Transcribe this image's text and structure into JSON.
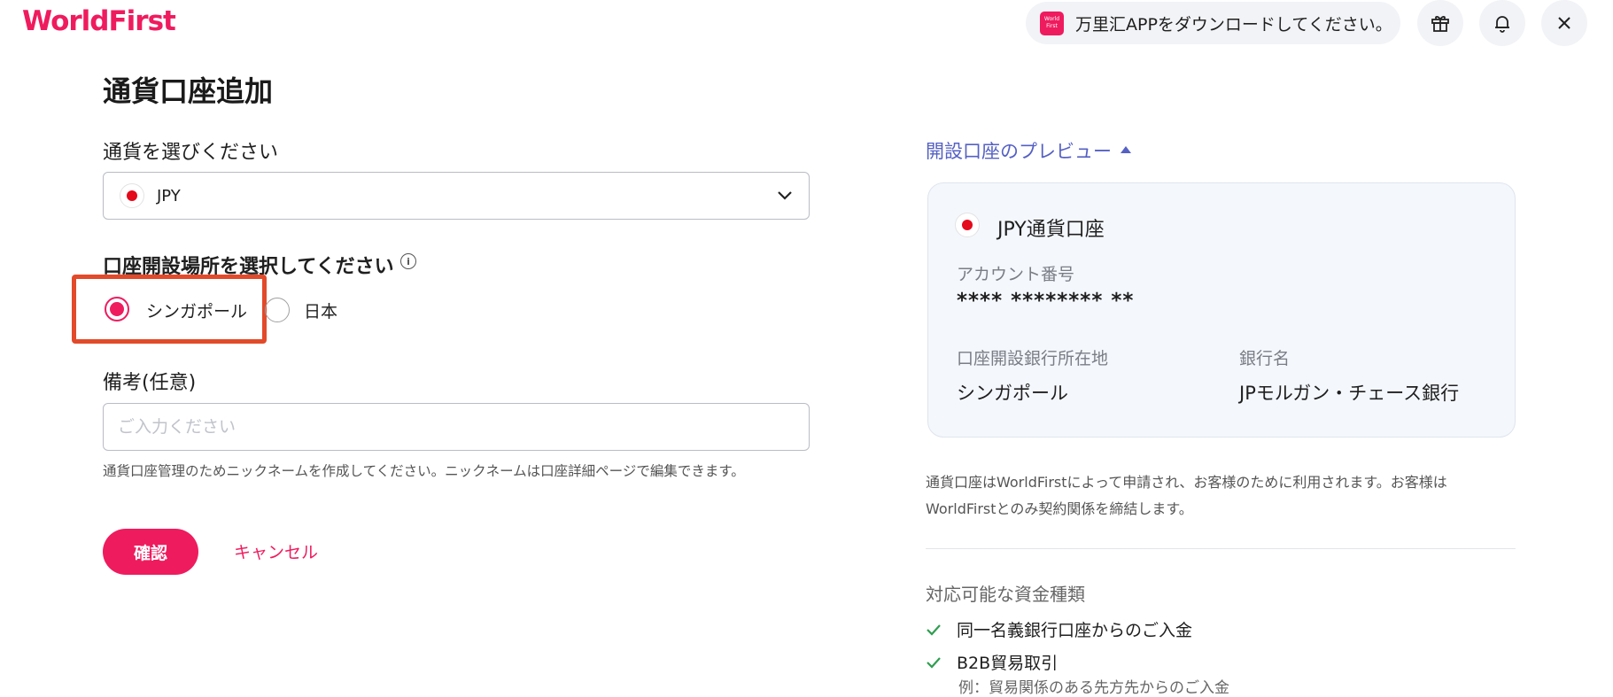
{
  "header": {
    "logo": "WorldFirst",
    "pill_logo_line1": "World",
    "pill_logo_line2": "First",
    "download_text": "万里汇APPをダウンロードしてください。",
    "icons": [
      "gift-icon",
      "bell-icon",
      "close-icon"
    ]
  },
  "form": {
    "title": "通貨口座追加",
    "currency_label": "通貨を選びください",
    "currency_value": "JPY",
    "location_label": "口座開設場所を選択してください",
    "location_options": [
      {
        "label": "シンガポール",
        "selected": true
      },
      {
        "label": "日本",
        "selected": false
      }
    ],
    "remarks_label": "備考(任意)",
    "remarks_placeholder": "ご入力ください",
    "remarks_value": "",
    "hint": "通貨口座管理のためニックネームを作成してください。ニックネームは口座詳細ページで編集できます。",
    "confirm_label": "確認",
    "cancel_label": "キャンセル"
  },
  "preview": {
    "toggle_label": "開設口座のプレビュー",
    "card_title": "JPY通貨口座",
    "account_number_label": "アカウント番号",
    "account_number": "**** ******** **",
    "bank_location_label": "口座開設銀行所在地",
    "bank_location": "シンガポール",
    "bank_name_label": "銀行名",
    "bank_name": "JPモルガン・チェース銀行",
    "note": "通貨口座はWorldFirstによって申請され、お客様のために利用されます。お客様はWorldFirstとのみ契約関係を締結します。",
    "fund_types_title": "対応可能な資金種類",
    "fund_types": [
      "同一名義銀行口座からのご入金",
      "B2B貿易取引"
    ],
    "fund_sub": "例：貿易関係のある先方先からのご入金"
  },
  "colors": {
    "brand": "#ef1b5f",
    "link": "#5561c4",
    "highlight": "#e24a2a"
  }
}
